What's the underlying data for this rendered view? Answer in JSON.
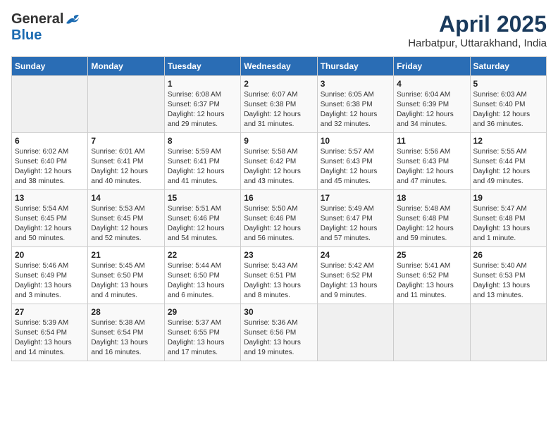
{
  "header": {
    "logo_general": "General",
    "logo_blue": "Blue",
    "title": "April 2025",
    "location": "Harbatpur, Uttarakhand, India"
  },
  "days_of_week": [
    "Sunday",
    "Monday",
    "Tuesday",
    "Wednesday",
    "Thursday",
    "Friday",
    "Saturday"
  ],
  "weeks": [
    [
      {
        "day": "",
        "info": ""
      },
      {
        "day": "",
        "info": ""
      },
      {
        "day": "1",
        "info": "Sunrise: 6:08 AM\nSunset: 6:37 PM\nDaylight: 12 hours\nand 29 minutes."
      },
      {
        "day": "2",
        "info": "Sunrise: 6:07 AM\nSunset: 6:38 PM\nDaylight: 12 hours\nand 31 minutes."
      },
      {
        "day": "3",
        "info": "Sunrise: 6:05 AM\nSunset: 6:38 PM\nDaylight: 12 hours\nand 32 minutes."
      },
      {
        "day": "4",
        "info": "Sunrise: 6:04 AM\nSunset: 6:39 PM\nDaylight: 12 hours\nand 34 minutes."
      },
      {
        "day": "5",
        "info": "Sunrise: 6:03 AM\nSunset: 6:40 PM\nDaylight: 12 hours\nand 36 minutes."
      }
    ],
    [
      {
        "day": "6",
        "info": "Sunrise: 6:02 AM\nSunset: 6:40 PM\nDaylight: 12 hours\nand 38 minutes."
      },
      {
        "day": "7",
        "info": "Sunrise: 6:01 AM\nSunset: 6:41 PM\nDaylight: 12 hours\nand 40 minutes."
      },
      {
        "day": "8",
        "info": "Sunrise: 5:59 AM\nSunset: 6:41 PM\nDaylight: 12 hours\nand 41 minutes."
      },
      {
        "day": "9",
        "info": "Sunrise: 5:58 AM\nSunset: 6:42 PM\nDaylight: 12 hours\nand 43 minutes."
      },
      {
        "day": "10",
        "info": "Sunrise: 5:57 AM\nSunset: 6:43 PM\nDaylight: 12 hours\nand 45 minutes."
      },
      {
        "day": "11",
        "info": "Sunrise: 5:56 AM\nSunset: 6:43 PM\nDaylight: 12 hours\nand 47 minutes."
      },
      {
        "day": "12",
        "info": "Sunrise: 5:55 AM\nSunset: 6:44 PM\nDaylight: 12 hours\nand 49 minutes."
      }
    ],
    [
      {
        "day": "13",
        "info": "Sunrise: 5:54 AM\nSunset: 6:45 PM\nDaylight: 12 hours\nand 50 minutes."
      },
      {
        "day": "14",
        "info": "Sunrise: 5:53 AM\nSunset: 6:45 PM\nDaylight: 12 hours\nand 52 minutes."
      },
      {
        "day": "15",
        "info": "Sunrise: 5:51 AM\nSunset: 6:46 PM\nDaylight: 12 hours\nand 54 minutes."
      },
      {
        "day": "16",
        "info": "Sunrise: 5:50 AM\nSunset: 6:46 PM\nDaylight: 12 hours\nand 56 minutes."
      },
      {
        "day": "17",
        "info": "Sunrise: 5:49 AM\nSunset: 6:47 PM\nDaylight: 12 hours\nand 57 minutes."
      },
      {
        "day": "18",
        "info": "Sunrise: 5:48 AM\nSunset: 6:48 PM\nDaylight: 12 hours\nand 59 minutes."
      },
      {
        "day": "19",
        "info": "Sunrise: 5:47 AM\nSunset: 6:48 PM\nDaylight: 13 hours\nand 1 minute."
      }
    ],
    [
      {
        "day": "20",
        "info": "Sunrise: 5:46 AM\nSunset: 6:49 PM\nDaylight: 13 hours\nand 3 minutes."
      },
      {
        "day": "21",
        "info": "Sunrise: 5:45 AM\nSunset: 6:50 PM\nDaylight: 13 hours\nand 4 minutes."
      },
      {
        "day": "22",
        "info": "Sunrise: 5:44 AM\nSunset: 6:50 PM\nDaylight: 13 hours\nand 6 minutes."
      },
      {
        "day": "23",
        "info": "Sunrise: 5:43 AM\nSunset: 6:51 PM\nDaylight: 13 hours\nand 8 minutes."
      },
      {
        "day": "24",
        "info": "Sunrise: 5:42 AM\nSunset: 6:52 PM\nDaylight: 13 hours\nand 9 minutes."
      },
      {
        "day": "25",
        "info": "Sunrise: 5:41 AM\nSunset: 6:52 PM\nDaylight: 13 hours\nand 11 minutes."
      },
      {
        "day": "26",
        "info": "Sunrise: 5:40 AM\nSunset: 6:53 PM\nDaylight: 13 hours\nand 13 minutes."
      }
    ],
    [
      {
        "day": "27",
        "info": "Sunrise: 5:39 AM\nSunset: 6:54 PM\nDaylight: 13 hours\nand 14 minutes."
      },
      {
        "day": "28",
        "info": "Sunrise: 5:38 AM\nSunset: 6:54 PM\nDaylight: 13 hours\nand 16 minutes."
      },
      {
        "day": "29",
        "info": "Sunrise: 5:37 AM\nSunset: 6:55 PM\nDaylight: 13 hours\nand 17 minutes."
      },
      {
        "day": "30",
        "info": "Sunrise: 5:36 AM\nSunset: 6:56 PM\nDaylight: 13 hours\nand 19 minutes."
      },
      {
        "day": "",
        "info": ""
      },
      {
        "day": "",
        "info": ""
      },
      {
        "day": "",
        "info": ""
      }
    ]
  ]
}
